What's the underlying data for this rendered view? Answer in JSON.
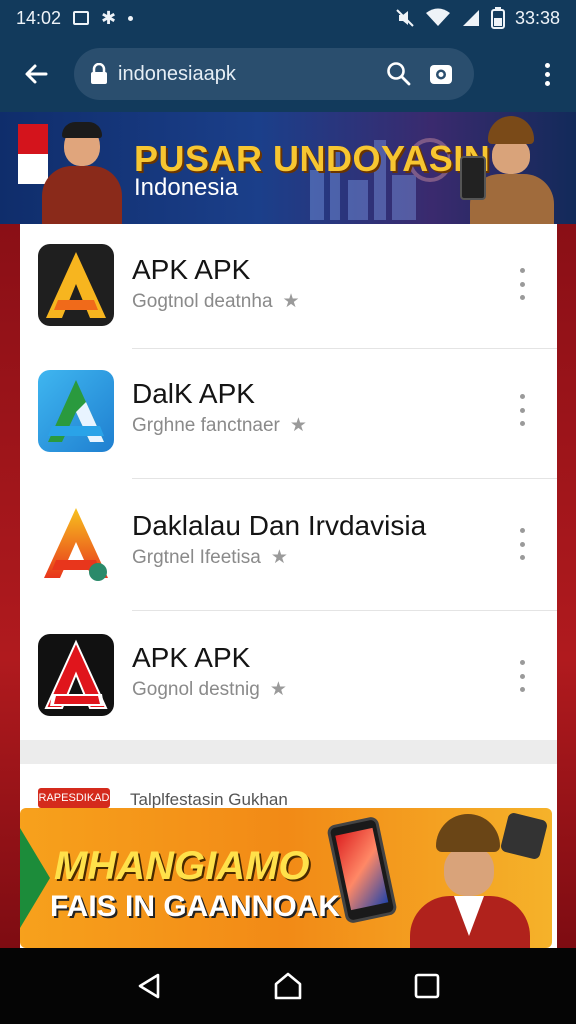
{
  "status_bar": {
    "time": "14:02",
    "clock_right": "33:38"
  },
  "browser": {
    "url": "indonesiaapk",
    "icons": [
      "back-arrow-icon",
      "lock-icon",
      "search-icon",
      "camera-icon",
      "more-vert-icon"
    ]
  },
  "top_banner": {
    "title": "PUSAR UNDOYASIN",
    "subtitle": "Indonesia"
  },
  "apps": [
    {
      "name": "APK APK",
      "subtitle": "Gogtnol deatnha",
      "icon_colors": [
        "#f7b51f",
        "#f06a1a"
      ]
    },
    {
      "name": "DalK APK",
      "subtitle": "Grghne fanctnaer",
      "icon_colors": [
        "#2a9a3e",
        "#2aa3e8"
      ]
    },
    {
      "name": "Daklalau Dan Irvdavisia",
      "subtitle": "Grgtnel Ifeetisa",
      "icon_colors": [
        "#f7c21f",
        "#e8361c"
      ]
    },
    {
      "name": "APK APK",
      "subtitle": "Gognol destnig",
      "icon_colors": [
        "#e0151c",
        "#111111"
      ]
    }
  ],
  "section": {
    "tag": "RAPESDIKAD",
    "label": "Talplfestasin Gukhan"
  },
  "promo": {
    "title": "MHANGIAMO",
    "subtitle": "FAIS IN GAANNOAK"
  },
  "nav": {
    "icons": [
      "back-triangle-icon",
      "home-icon",
      "recents-square-icon"
    ]
  },
  "colors": {
    "chrome": "#123a5c",
    "accent_gold": "#f7c631",
    "red_bg": "#b01a1e",
    "promo_orange": "#f28a16"
  }
}
